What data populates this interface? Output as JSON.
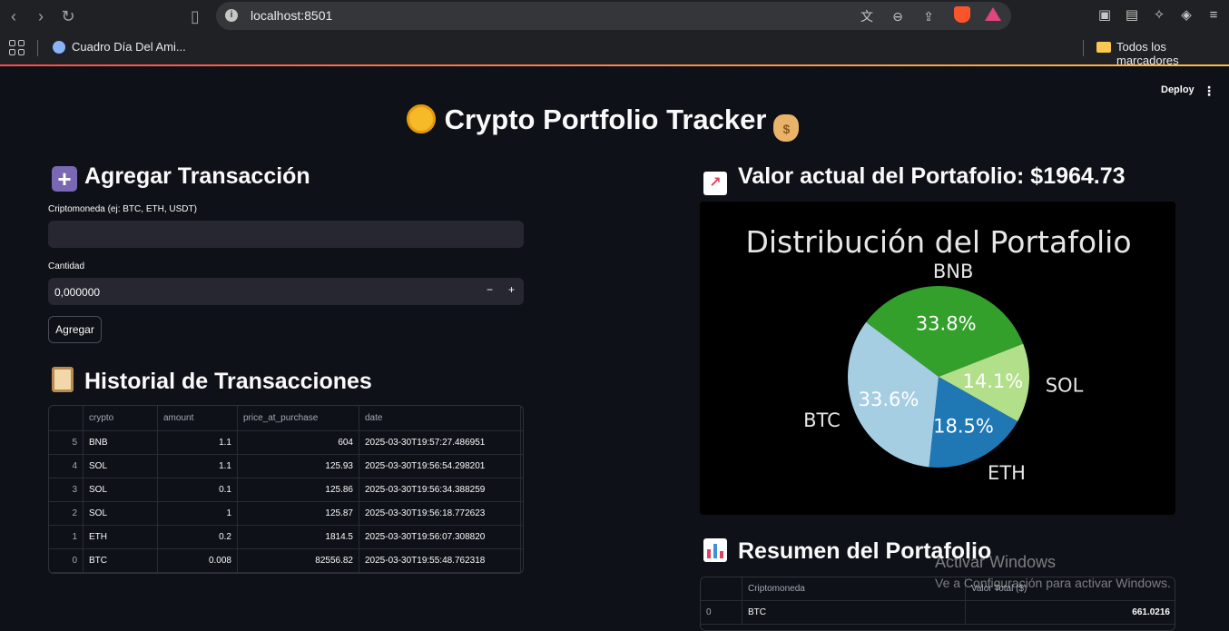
{
  "browser": {
    "url": "localhost:8501",
    "bookmark_1": "Cuadro Día Del Ami...",
    "bookmark_folder": "Todos los marcadores"
  },
  "app": {
    "deploy": "Deploy",
    "title": "Crypto Portfolio Tracker"
  },
  "form": {
    "heading": "Agregar Transacción",
    "crypto_label": "Criptomoneda (ej: BTC, ETH, USDT)",
    "crypto_value": "",
    "qty_label": "Cantidad",
    "qty_value": "0,000000",
    "minus": "−",
    "plus": "+",
    "submit": "Agregar"
  },
  "history": {
    "heading": "Historial de Transacciones",
    "columns": [
      "",
      "crypto",
      "amount",
      "price_at_purchase",
      "date"
    ],
    "rows": [
      {
        "idx": "5",
        "crypto": "BNB",
        "amount": "1.1",
        "price": "604",
        "date": "2025-03-30T19:57:27.486951"
      },
      {
        "idx": "4",
        "crypto": "SOL",
        "amount": "1.1",
        "price": "125.93",
        "date": "2025-03-30T19:56:54.298201"
      },
      {
        "idx": "3",
        "crypto": "SOL",
        "amount": "0.1",
        "price": "125.86",
        "date": "2025-03-30T19:56:34.388259"
      },
      {
        "idx": "2",
        "crypto": "SOL",
        "amount": "1",
        "price": "125.87",
        "date": "2025-03-30T19:56:18.772623"
      },
      {
        "idx": "1",
        "crypto": "ETH",
        "amount": "0.2",
        "price": "1814.5",
        "date": "2025-03-30T19:56:07.308820"
      },
      {
        "idx": "0",
        "crypto": "BTC",
        "amount": "0.008",
        "price": "82556.82",
        "date": "2025-03-30T19:55:48.762318"
      }
    ]
  },
  "value": {
    "heading": "Valor actual del Portafolio: $1964.73"
  },
  "chart_data": {
    "type": "pie",
    "title": "Distribución del Portafolio",
    "categories": [
      "BNB",
      "SOL",
      "ETH",
      "BTC"
    ],
    "values": [
      33.8,
      14.1,
      18.5,
      33.6
    ],
    "labels": [
      "33.8%",
      "14.1%",
      "18.5%",
      "33.6%"
    ],
    "colors": [
      "#33a02c",
      "#b2df8a",
      "#1f78b4",
      "#a6cee3"
    ],
    "background": "#000000"
  },
  "summary": {
    "heading": "Resumen del Portafolio",
    "columns": [
      "",
      "Criptomoneda",
      "Valor Total ($)"
    ],
    "rows": [
      {
        "idx": "0",
        "crypto": "BTC",
        "value": "661.0216"
      }
    ]
  },
  "watermark": {
    "line1": "Activar Windows",
    "line2": "Ve a Configuración para activar Windows."
  }
}
